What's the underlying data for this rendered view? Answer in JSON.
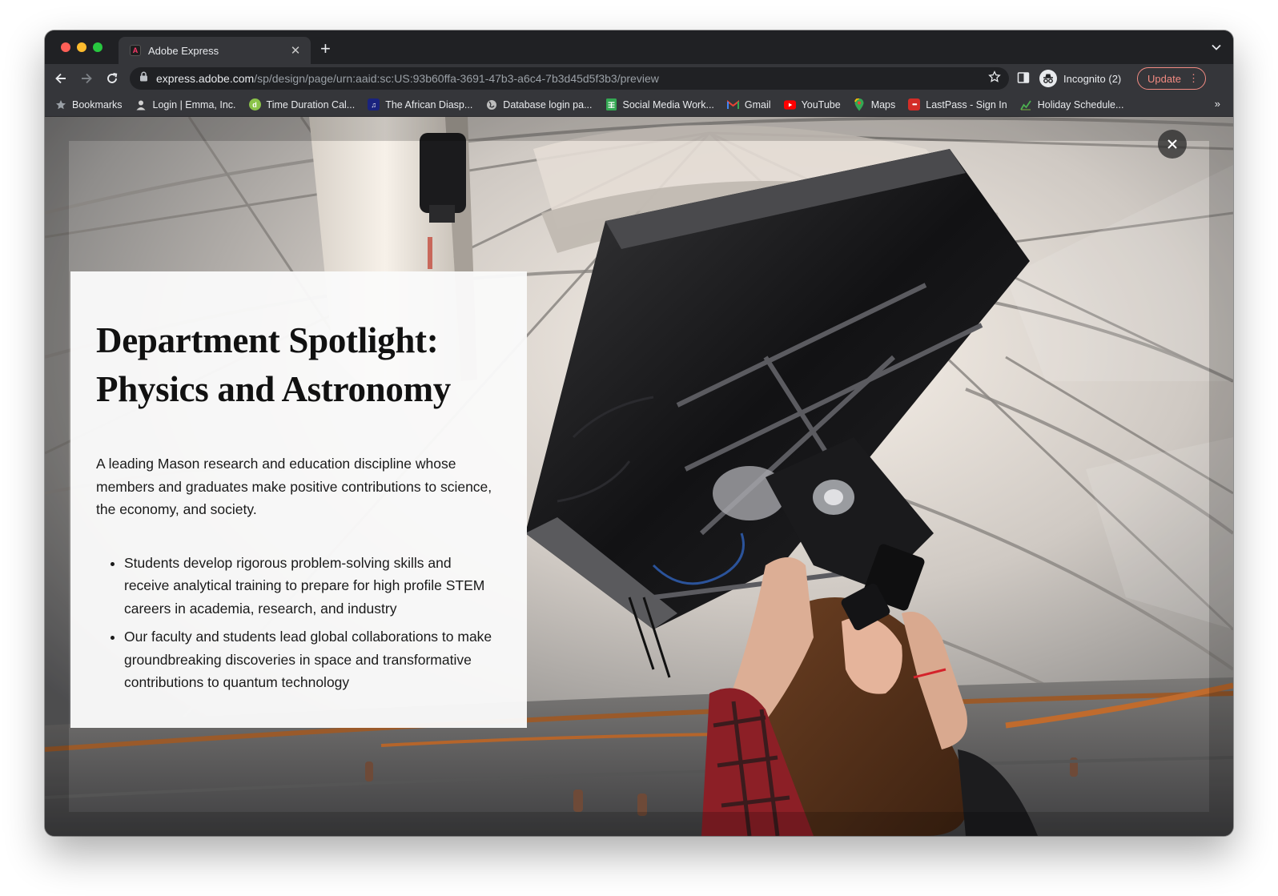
{
  "browser": {
    "tab_title": "Adobe Express",
    "tab_favicon_letter": "A",
    "url_host": "express.adobe.com",
    "url_path": "/sp/design/page/urn:aaid:sc:US:93b60ffa-3691-47b3-a6c4-7b3d45d5f3b3/preview",
    "incognito_label": "Incognito (2)",
    "update_label": "Update"
  },
  "bookmarks": [
    {
      "label": "Bookmarks",
      "icon": "star-icon",
      "color": "#9aa0a6"
    },
    {
      "label": "Login | Emma, Inc.",
      "icon": "person-icon",
      "color": "#c8c8c8"
    },
    {
      "label": "Time Duration Cal...",
      "icon": "dot-icon",
      "color": "#8bc34a"
    },
    {
      "label": "The African Diasp...",
      "icon": "music-icon",
      "color": "#3f51b5"
    },
    {
      "label": "Database login pa...",
      "icon": "globe-icon",
      "color": "#bdbdbd"
    },
    {
      "label": "Social Media Work...",
      "icon": "sheets-icon",
      "color": "#34a853"
    },
    {
      "label": "Gmail",
      "icon": "gmail-icon",
      "color": "#ea4335"
    },
    {
      "label": "YouTube",
      "icon": "youtube-icon",
      "color": "#ff0000"
    },
    {
      "label": "Maps",
      "icon": "maps-icon",
      "color": "#34a853"
    },
    {
      "label": "LastPass - Sign In",
      "icon": "lastpass-icon",
      "color": "#d32d27"
    },
    {
      "label": "Holiday Schedule...",
      "icon": "chart-icon",
      "color": "#4caf50"
    }
  ],
  "card": {
    "title_line1": "Department Spotlight:",
    "title_line2": "Physics and Astronomy",
    "intro": "A leading Mason research and education discipline whose members and graduates make positive contributions to science, the economy, and society.",
    "bullets": [
      "Students develop rigorous problem-solving skills and receive analytical training to prepare for high profile STEM careers in academia, research, and industry",
      "Our faculty and students lead global collaborations to make groundbreaking discoveries in space and transformative contributions to quantum technology"
    ]
  },
  "colors": {
    "accent_update": "#f28b82",
    "chrome_dark": "#202124",
    "chrome_toolbar": "#35363a"
  }
}
